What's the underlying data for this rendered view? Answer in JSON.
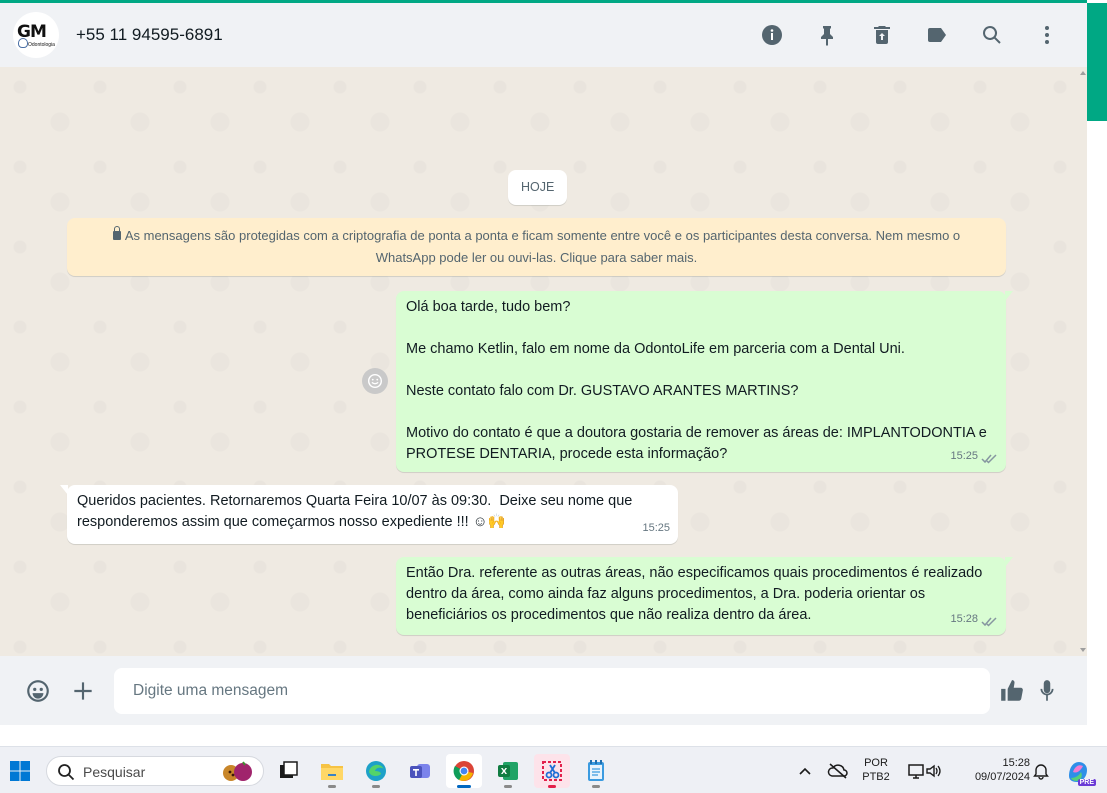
{
  "colors": {
    "accent": "#00a884",
    "outgoing_bubble": "#d9fdd3",
    "incoming_bubble": "#ffffff",
    "notice_bg": "#ffeecd",
    "chat_bg": "#efeae2"
  },
  "header": {
    "avatar_logo": "GM",
    "avatar_subtext": "Odontologia",
    "contact_name": "+55 11 94595-6891",
    "icons": [
      "info-icon",
      "pin-icon",
      "delete-icon",
      "label-icon",
      "search-icon",
      "more-options-icon"
    ]
  },
  "chat": {
    "date_chip": "HOJE",
    "encryption_notice": "As mensagens são protegidas com a criptografia de ponta a ponta e ficam somente entre você e os participantes desta conversa. Nem mesmo o WhatsApp pode ler ou ouvi-las. Clique para saber mais.",
    "messages": [
      {
        "direction": "out",
        "text": "Olá boa tarde, tudo bem?\n\nMe chamo Ketlin, falo em nome da OdontoLife em parceria com a Dental Uni.\n\nNeste contato falo com Dr. GUSTAVO ARANTES MARTINS?\n\nMotivo do contato é que a doutora gostaria de remover as áreas de: IMPLANTODONTIA e PROTESE DENTARIA, procede esta informação?",
        "time": "15:25"
      },
      {
        "direction": "in",
        "text": "Queridos pacientes. Retornaremos Quarta Feira 10/07 às 09:30.  Deixe seu nome que responderemos assim que começarmos nosso expediente !!! ☺🙌",
        "time": "15:25"
      },
      {
        "direction": "out",
        "text": "Então Dra. referente as outras áreas, não especificamos quais procedimentos é realizado dentro da área, como ainda faz alguns procedimentos, a Dra. poderia orientar os beneficiários os procedimentos que não realiza dentro da área.",
        "time": "15:28"
      }
    ]
  },
  "composer": {
    "placeholder": "Digite uma mensagem"
  },
  "taskbar": {
    "search_placeholder": "Pesquisar",
    "language": "POR",
    "keyboard": "PTB2",
    "time": "15:28",
    "date": "09/07/2024",
    "copilot_badge": "PRE"
  }
}
